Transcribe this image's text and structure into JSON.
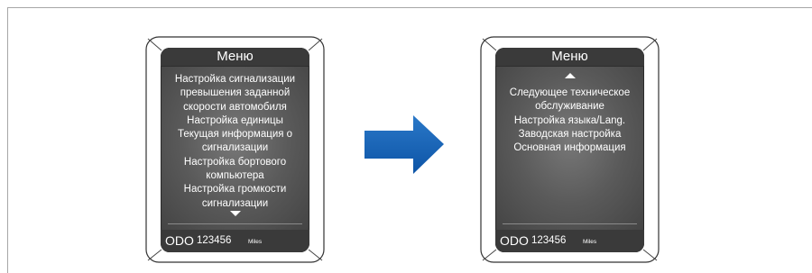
{
  "left_screen": {
    "title": "Меню",
    "items": [
      "Настройка сигнализации",
      "превышения заданной",
      "скорости автомобиля",
      "Настройка единицы",
      "Текущая информация о",
      "сигнализации",
      "Настройка бортового",
      "компьютера",
      "Настройка громкости",
      "сигнализации"
    ],
    "scroll_indicator": "arrow-down",
    "odo_label": "ODO",
    "odo_value": "123456",
    "odo_unit": "Miles"
  },
  "transition_arrow": {
    "color": "#1565c0"
  },
  "right_screen": {
    "title": "Меню",
    "scroll_indicator": "arrow-up",
    "items": [
      "Следующее техническое",
      "обслуживание",
      "Настройка языка/Lang.",
      "Заводская настройка",
      "Основная информация"
    ],
    "odo_label": "ODO",
    "odo_value": "123456",
    "odo_unit": "Miles"
  }
}
